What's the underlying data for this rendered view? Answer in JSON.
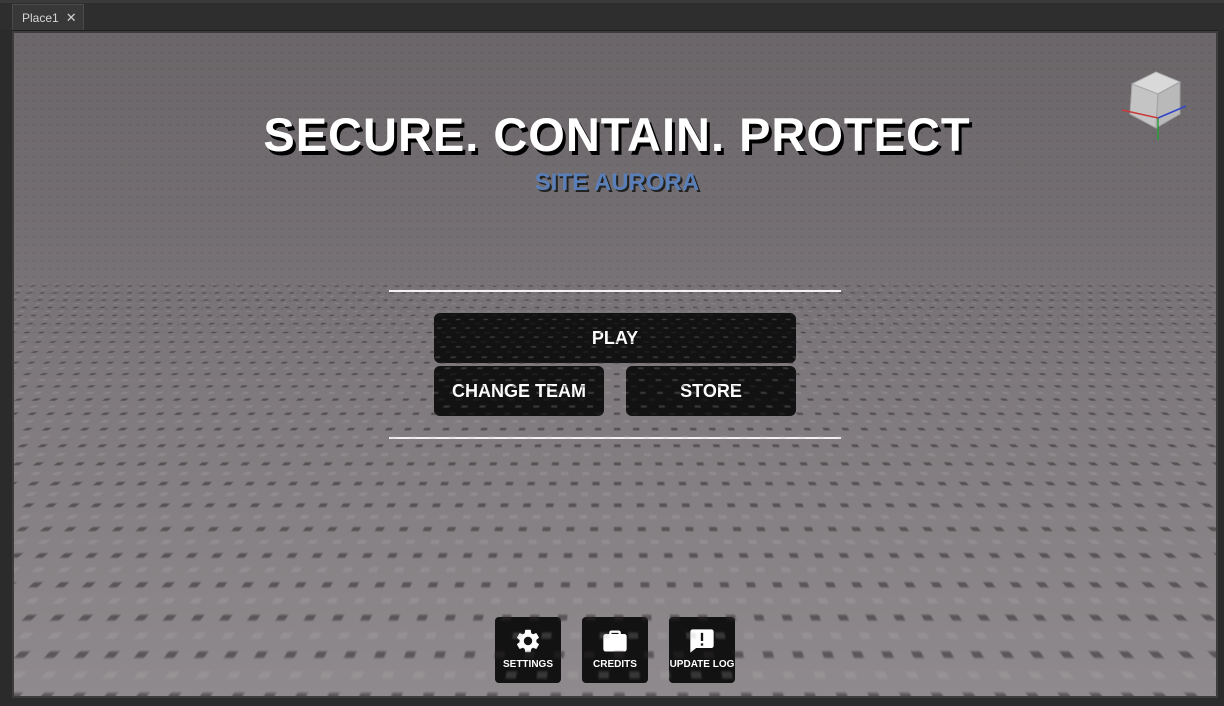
{
  "tab": {
    "label": "Place1",
    "close_glyph": "✕"
  },
  "hero": {
    "title": "SECURE. CONTAIN. PROTECT",
    "subtitle": "SITE AURORA"
  },
  "menu": {
    "play_label": "PLAY",
    "change_team_label": "CHANGE TEAM",
    "store_label": "STORE"
  },
  "bottom_buttons": [
    {
      "label": "SETTINGS",
      "icon": "gear-icon"
    },
    {
      "label": "CREDITS",
      "icon": "briefcase-icon"
    },
    {
      "label": "UPDATE LOG",
      "icon": "alert-message-icon"
    }
  ],
  "colors": {
    "subtitle": "#5a7fb8",
    "button_bg": "#121212",
    "divider": "#f2f2f2"
  }
}
